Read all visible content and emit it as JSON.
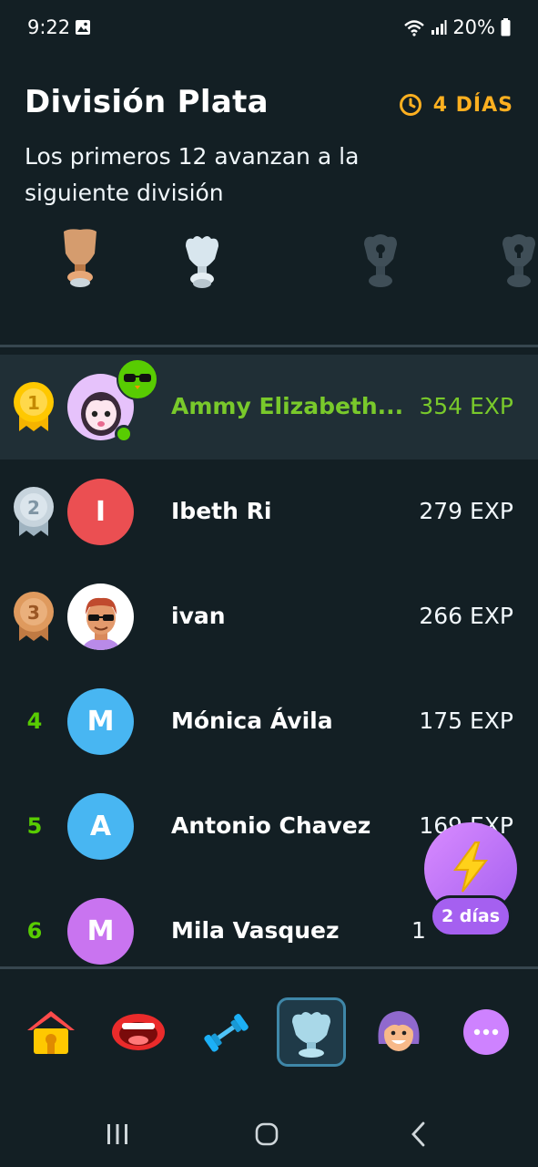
{
  "status": {
    "time": "9:22",
    "battery": "20%",
    "icons": [
      "image-icon",
      "wifi-icon",
      "signal-icon",
      "battery-icon"
    ]
  },
  "header": {
    "title": "División Plata",
    "timer": "4 DÍAS",
    "subtitle": "Los primeros 12 avanzan a la siguiente división"
  },
  "leaderboard": [
    {
      "rank": "1",
      "name": "Ammy Elizabeth...",
      "exp": "354 EXP",
      "avatar_letter": "",
      "avatar_color": "#d6a6f5",
      "current_user": true
    },
    {
      "rank": "2",
      "name": "Ibeth Ri",
      "exp": "279 EXP",
      "avatar_letter": "I",
      "avatar_color": "#eb4f52"
    },
    {
      "rank": "3",
      "name": "ivan",
      "exp": "266 EXP",
      "avatar_letter": "",
      "avatar_color": "#ffffff"
    },
    {
      "rank": "4",
      "name": "Mónica Ávila",
      "exp": "175 EXP",
      "avatar_letter": "M",
      "avatar_color": "#48b6f2"
    },
    {
      "rank": "5",
      "name": "Antonio Chavez",
      "exp": "169 EXP",
      "avatar_letter": "A",
      "avatar_color": "#48b6f2"
    },
    {
      "rank": "6",
      "name": "Mila Vasquez",
      "exp": "1",
      "avatar_letter": "M",
      "avatar_color": "#c974f0"
    }
  ],
  "boost": {
    "label": "2 días"
  },
  "nav": [
    "home-icon",
    "speaking-icon",
    "practice-icon",
    "leagues-icon",
    "profile-icon",
    "more-icon"
  ],
  "colors": {
    "background": "#131f24",
    "highlight_row": "#202f36",
    "accent_green": "#58cc02",
    "timer_orange": "#ffb020"
  }
}
